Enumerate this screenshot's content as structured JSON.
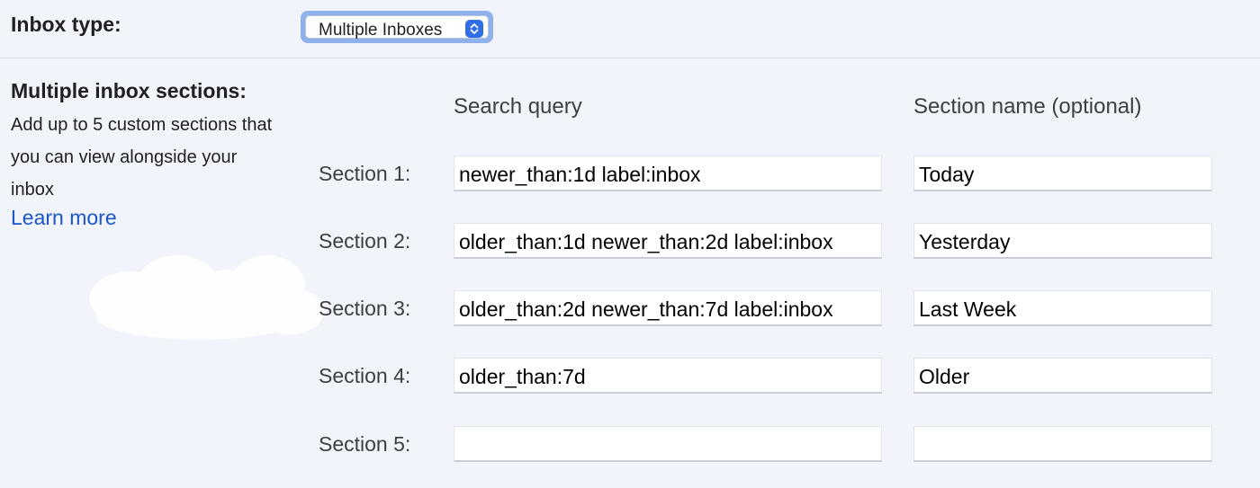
{
  "inbox_type": {
    "label": "Inbox type:",
    "selected": "Multiple Inboxes"
  },
  "sections_info": {
    "title": "Multiple inbox sections:",
    "description": "Add up to 5 custom sections that you can view alongside your inbox",
    "learn_more": "Learn more"
  },
  "columns": {
    "query_header": "Search query",
    "name_header": "Section name (optional)"
  },
  "sections": [
    {
      "label": "Section 1:",
      "query": "newer_than:1d label:inbox",
      "name": "Today"
    },
    {
      "label": "Section 2:",
      "query": "older_than:1d newer_than:2d label:inbox",
      "name": "Yesterday"
    },
    {
      "label": "Section 3:",
      "query": "older_than:2d newer_than:7d label:inbox",
      "name": "Last Week"
    },
    {
      "label": "Section 4:",
      "query": "older_than:7d",
      "name": "Older"
    },
    {
      "label": "Section 5:",
      "query": "",
      "name": ""
    }
  ],
  "colors": {
    "background": "#f1f4fa",
    "link": "#1a56c9",
    "select_focus": "#8fb1ec",
    "select_arrow": "#2f6ee6"
  }
}
